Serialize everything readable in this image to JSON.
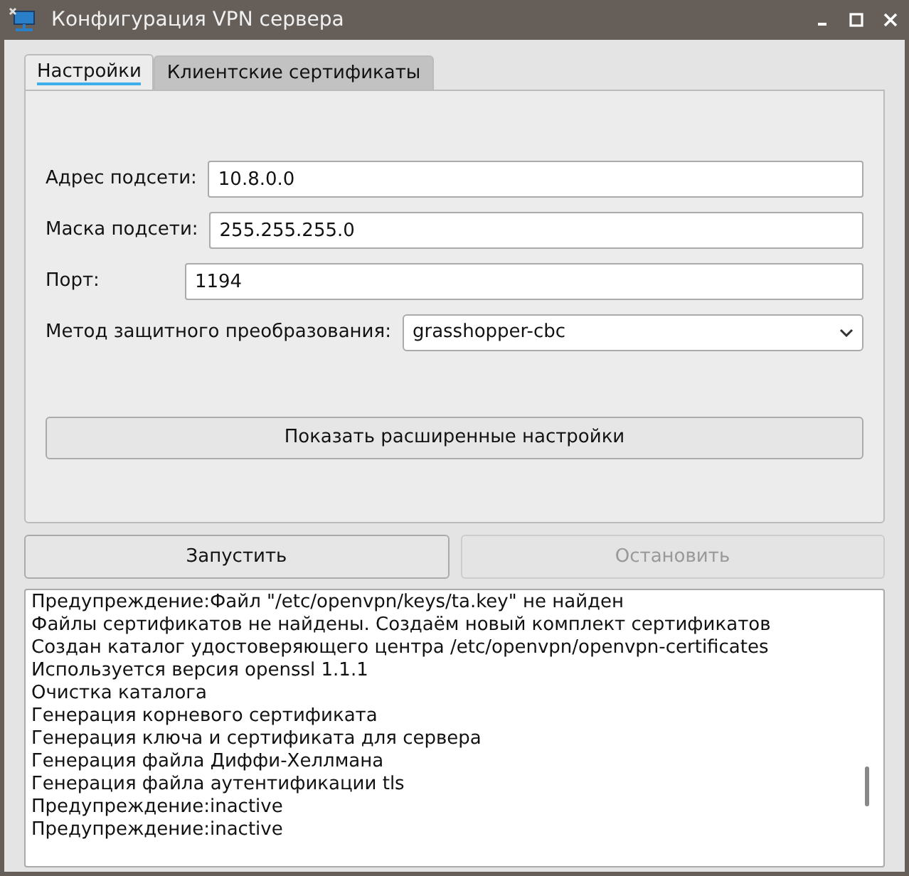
{
  "window": {
    "title": "Конфигурация VPN сервера"
  },
  "tabs": [
    {
      "label": "Настройки",
      "selected": true
    },
    {
      "label": "Клиентские сертификаты",
      "selected": false
    }
  ],
  "fields": [
    {
      "kind": "text",
      "label": "Адрес подсети:",
      "value": "10.8.0.0"
    },
    {
      "kind": "text",
      "label": "Маска подсети:",
      "value": "255.255.255.0"
    },
    {
      "kind": "text",
      "label": "Порт:",
      "value": "1194"
    },
    {
      "kind": "select",
      "label": "Метод защитного преобразования:",
      "value": "grasshopper-cbc"
    }
  ],
  "advanced_button": {
    "label": "Показать расширенные настройки"
  },
  "actions": [
    {
      "label": "Запустить",
      "disabled": false
    },
    {
      "label": "Остановить",
      "disabled": true
    }
  ],
  "log": [
    "Предупреждение:Файл \"/etc/openvpn/keys/ta.key\" не найден",
    "Файлы сертификатов не найдены. Создаём новый комплект сертификатов",
    "Создан каталог удостоверяющего центра /etc/openvpn/openvpn-certificates",
    "Используется версия openssl 1.1.1",
    "Очистка каталога",
    "Генерация корневого сертификата",
    "Генерация ключа и сертификата для сервера",
    "Генерация файла Диффи-Хеллмана",
    "Генерация файла аутентификации tls",
    "Предупреждение:inactive",
    "Предупреждение:inactive"
  ]
}
